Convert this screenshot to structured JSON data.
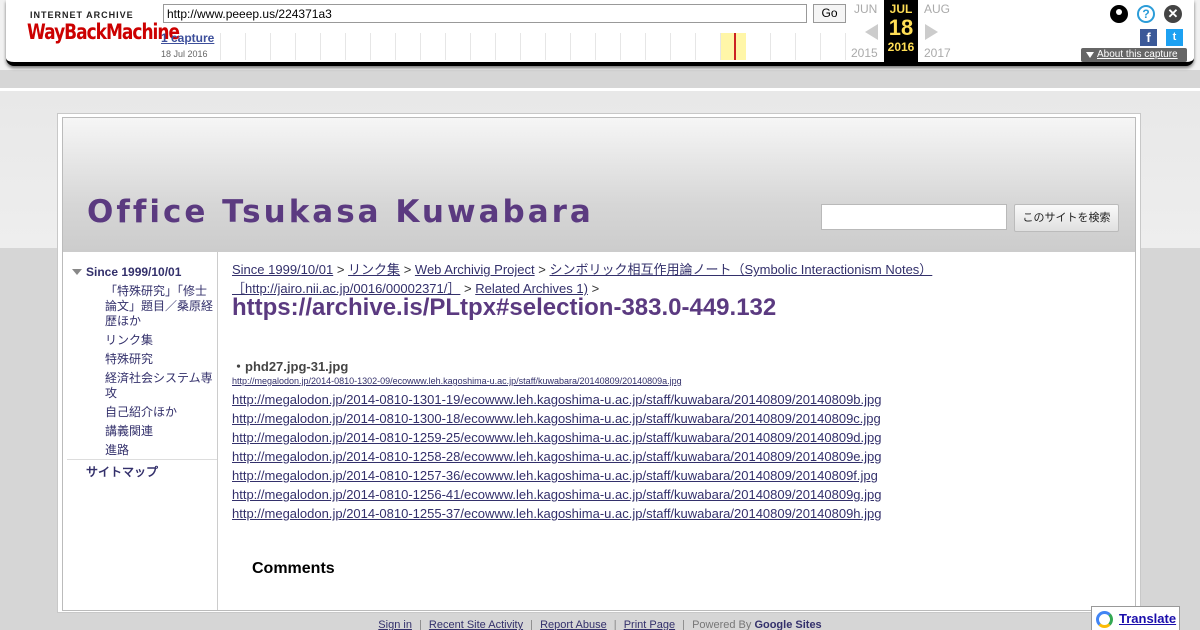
{
  "wayback": {
    "logo_top": "INTERNET ARCHIVE",
    "logo_main": "WayBackMachine",
    "url": "http://www.peeep.us/224371a3",
    "go_label": "Go",
    "captures": "1 capture",
    "capture_date": "18 Jul 2016",
    "prev_month": "JUN",
    "cur_month": "JUL",
    "next_month": "AUG",
    "cur_day": "18",
    "prev_year": "2015",
    "cur_year": "2016",
    "next_year": "2017",
    "about": "About this capture",
    "help_glyph": "?",
    "close_glyph": "✕",
    "fb_glyph": "f",
    "tw_glyph": "t"
  },
  "site": {
    "title": "Office Tsukasa Kuwabara",
    "search_button": "このサイトを検索"
  },
  "sidebar": {
    "top": "Since 1999/10/01",
    "items": [
      "「特殊研究」「修士論文」題目／桑原経歴ほか",
      "リンク集",
      "特殊研究",
      "経済社会システム専攻",
      "自己紹介ほか",
      "講義関連",
      "進路"
    ],
    "sitemap": "サイトマップ"
  },
  "breadcrumb": {
    "items": [
      "Since 1999/10/01",
      "リンク集",
      "Web Archivig Project",
      "シンボリック相互作用論ノート（Symbolic Interactionism Notes）［http://jairo.nii.ac.jp/0016/00002371/］",
      "Related Archives 1)"
    ],
    "separator": ">"
  },
  "main": {
    "title": "https://archive.is/PLtpx#selection-383.0-449.132",
    "caption": "・phd27.jpg-31.jpg",
    "small_link": "http://megalodon.jp/2014-0810-1302-09/ecowww.leh.kagoshima-u.ac.jp/staff/kuwabara/20140809/20140809a.jpg",
    "links": [
      "http://megalodon.jp/2014-0810-1301-19/ecowww.leh.kagoshima-u.ac.jp/staff/kuwabara/20140809/20140809b.jpg",
      "http://megalodon.jp/2014-0810-1300-18/ecowww.leh.kagoshima-u.ac.jp/staff/kuwabara/20140809/20140809c.jpg",
      "http://megalodon.jp/2014-0810-1259-25/ecowww.leh.kagoshima-u.ac.jp/staff/kuwabara/20140809/20140809d.jpg",
      "http://megalodon.jp/2014-0810-1258-28/ecowww.leh.kagoshima-u.ac.jp/staff/kuwabara/20140809/20140809e.jpg",
      "http://megalodon.jp/2014-0810-1257-36/ecowww.leh.kagoshima-u.ac.jp/staff/kuwabara/20140809/20140809f.jpg",
      "http://megalodon.jp/2014-0810-1256-41/ecowww.leh.kagoshima-u.ac.jp/staff/kuwabara/20140809/20140809g.jpg",
      "http://megalodon.jp/2014-0810-1255-37/ecowww.leh.kagoshima-u.ac.jp/staff/kuwabara/20140809/20140809h.jpg"
    ],
    "comments": "Comments"
  },
  "footer": {
    "sign_in": "Sign in",
    "recent": "Recent Site Activity",
    "abuse": "Report Abuse",
    "print": "Print Page",
    "powered": "Powered By",
    "google_sites": "Google Sites",
    "sep": "|"
  },
  "translate": {
    "label": "Translate"
  },
  "colors": {
    "title_purple": "#5b3a80",
    "link_navy": "#33306b"
  }
}
